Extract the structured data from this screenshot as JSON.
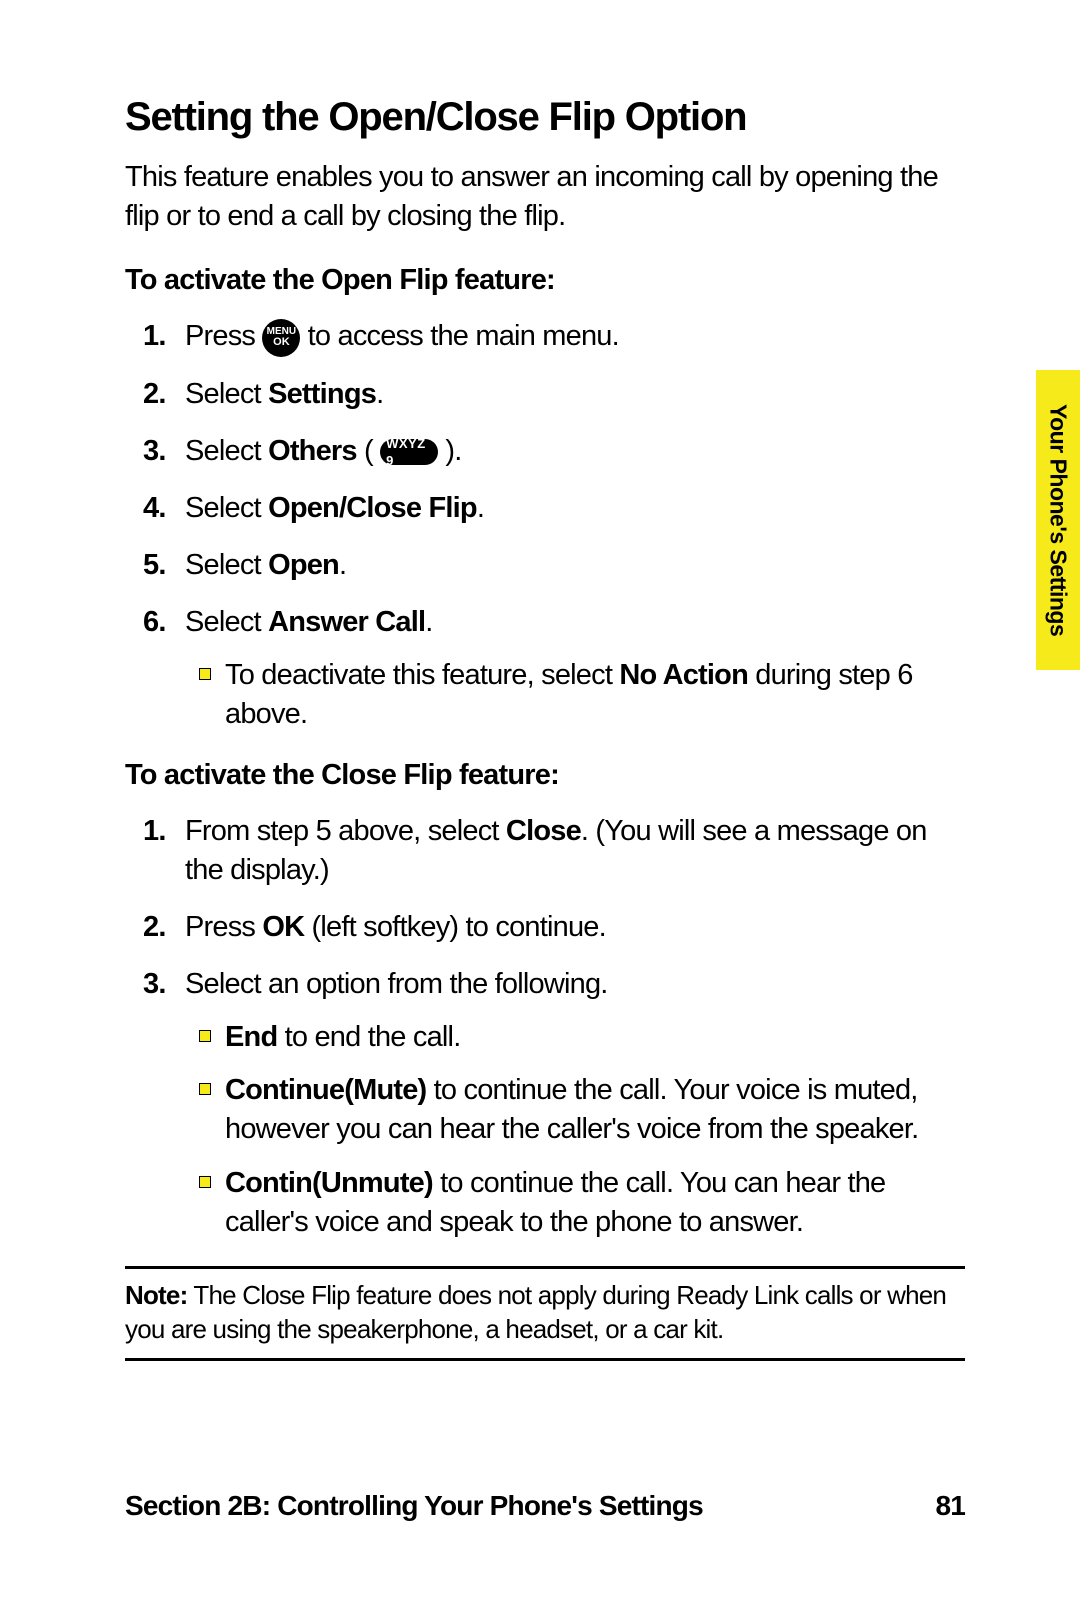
{
  "heading": "Setting the Open/Close Flip Option",
  "intro": "This feature enables you to answer an incoming call by opening the flip or to end a call by closing the flip.",
  "sectionA": {
    "title": "To activate the Open Flip feature:",
    "steps": {
      "s1a": "Press ",
      "s1b": " to access the main menu.",
      "s2a": "Select ",
      "s2b": "Settings",
      "s2c": ".",
      "s3a": "Select ",
      "s3b": "Others",
      "s3c": " ( ",
      "s3d": " ).",
      "s4a": "Select ",
      "s4b": "Open/Close Flip",
      "s4c": ".",
      "s5a": "Select ",
      "s5b": "Open",
      "s5c": ".",
      "s6a": "Select ",
      "s6b": "Answer Call",
      "s6c": ".",
      "sub1a": "To deactivate this feature, select ",
      "sub1b": "No Action",
      "sub1c": " during step 6 above."
    }
  },
  "sectionB": {
    "title": "To activate the Close Flip feature:",
    "steps": {
      "s1a": "From step 5 above, select ",
      "s1b": "Close",
      "s1c": ". (You will see a message on the display.)",
      "s2a": "Press ",
      "s2b": "OK",
      "s2c": " (left softkey) to continue.",
      "s3": "Select an option from the following.",
      "sub1a": "End",
      "sub1b": " to end the call.",
      "sub2a": "Continue(Mute)",
      "sub2b": " to continue the call. Your voice is muted, however you can hear the caller's voice from the speaker.",
      "sub3a": "Contin(Unmute)",
      "sub3b": " to continue the call. You can hear the caller's voice and speak to the phone to answer."
    }
  },
  "note": {
    "label": "Note:",
    "text": " The Close Flip feature does not apply during Ready Link calls or when you are using the speakerphone, a headset, or a car kit."
  },
  "sideTab": "Your Phone's Settings",
  "footer": {
    "section": "Section 2B: Controlling Your Phone's Settings",
    "page": "81"
  },
  "icons": {
    "menuOk": {
      "line1": "MENU",
      "line2": "OK"
    },
    "key9": "WXYZ 9"
  }
}
